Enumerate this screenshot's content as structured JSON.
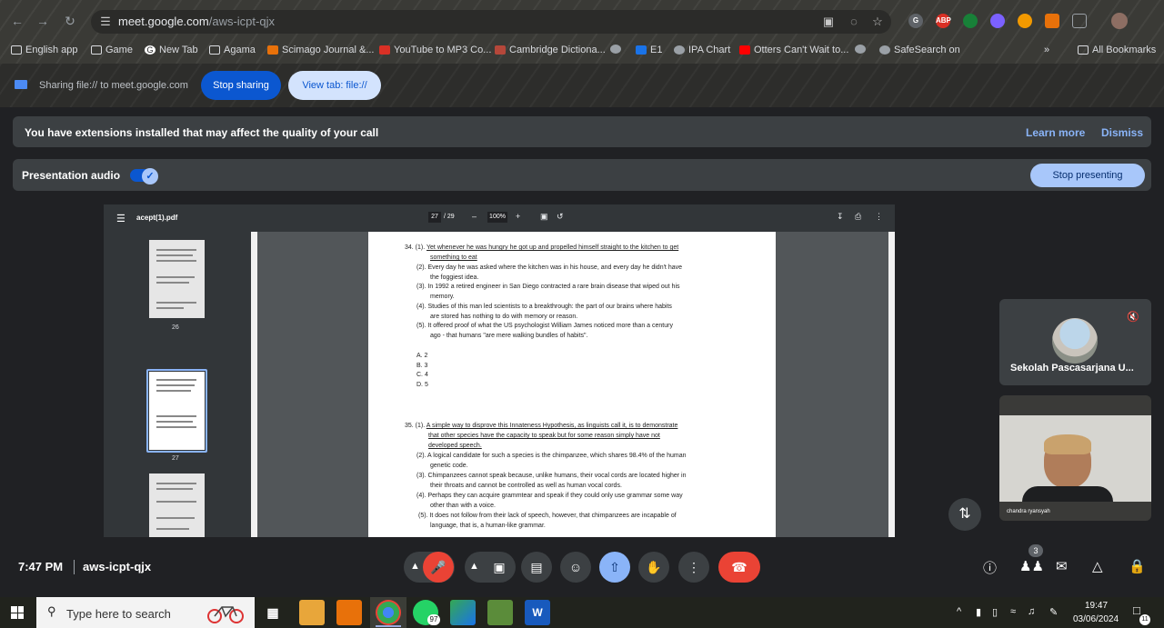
{
  "browser": {
    "url_host": "meet.google.com",
    "url_path": "/aws-icpt-qjx",
    "bookmarks": [
      {
        "label": "English app"
      },
      {
        "label": "Game"
      },
      {
        "label": "New Tab"
      },
      {
        "label": "Agama"
      },
      {
        "label": "Scimago Journal &..."
      },
      {
        "label": "YouTube to MP3 Co..."
      },
      {
        "label": "Cambridge Dictiona..."
      },
      {
        "label": "E1"
      },
      {
        "label": "IPA Chart"
      },
      {
        "label": "Otters Can't Wait to..."
      },
      {
        "label": "SafeSearch on"
      },
      {
        "label": "All Bookmarks"
      }
    ],
    "extension_labels": {
      "abp": "ABP"
    }
  },
  "share_bar": {
    "status": "Sharing file:// to meet.google.com",
    "stop_label": "Stop sharing",
    "view_label": "View tab: file://"
  },
  "meet": {
    "extension_warning": "You have extensions installed that may affect the quality of your call",
    "learn_more": "Learn more",
    "dismiss": "Dismiss",
    "presentation_audio": "Presentation audio",
    "presentation_audio_on": true,
    "stop_presenting": "Stop presenting",
    "participants": [
      {
        "name": "Sekolah Pascasarjana U...",
        "muted": true
      },
      {
        "name": "chandra ryansyah"
      }
    ],
    "people_count": "3",
    "time": "7:47 PM",
    "meeting_code": "aws-icpt-qjx",
    "accent": "#8ab4f8",
    "end_call_color": "#ea4335"
  },
  "pdf": {
    "file_name": "acept(1).pdf",
    "page_current": "27",
    "page_total": "/ 29",
    "zoom": "100%",
    "thumbs": [
      {
        "num": "26"
      },
      {
        "num": "27"
      },
      {
        "num": "28"
      }
    ],
    "q34": {
      "l1_num": "34. (1).",
      "l1": "Yet whenever he was hungry he got up and propelled himself straight to the kitchen to get",
      "l1b": "something to eat",
      "l2": "(2). Every day he was asked where the kitchen was in his house, and every day he didn't have",
      "l2b": "the foggiest idea.",
      "l3": "(3). In 1992 a retired engineer in San Diego contracted a rare brain disease that wiped out his",
      "l3b": "memory.",
      "l4": "(4). Studies of this man led scientists to a breakthrough: the part of our brains where habits",
      "l4b": "are stored has nothing to do with memory or reason.",
      "l5": "(5). It offered proof of what the US psychologist William James noticed more than a century",
      "l5b": "ago - that humans \"are mere walking bundles of habits\".",
      "options": [
        "A.  2",
        "B.  3",
        "C.  4",
        "D.  5"
      ]
    },
    "q35": {
      "l1_num": "35. (1).",
      "l1": "A simple way to disprove this Innateness Hypothesis, as linguists call it, is to demonstrate",
      "l1b": "that other species have the capacity to speak but for some reason simply have not",
      "l1c": "developed speech.",
      "l2": "(2). A logical candidate for such a species is the chimpanzee, which shares 98.4% of the human",
      "l2b": "genetic code.",
      "l3": "(3). Chimpanzees cannot speak because, unlike humans, their vocal cords are located higher in",
      "l3b": "their throats and cannot be controlled as well as human vocal cords.",
      "l4": "(4). Perhaps they can acquire grammtear and speak if they could only use grammar some way",
      "l4b": "other than with a voice.",
      "l5": "(5). It does not follow from their lack of speech, however, that chimpanzees are incapable of",
      "l5b": "language, that is, a human-like grammar."
    }
  },
  "taskbar": {
    "search_placeholder": "Type here to search",
    "whatsapp_badge": "97",
    "time": "19:47",
    "date": "03/06/2024",
    "notifications": "11"
  }
}
